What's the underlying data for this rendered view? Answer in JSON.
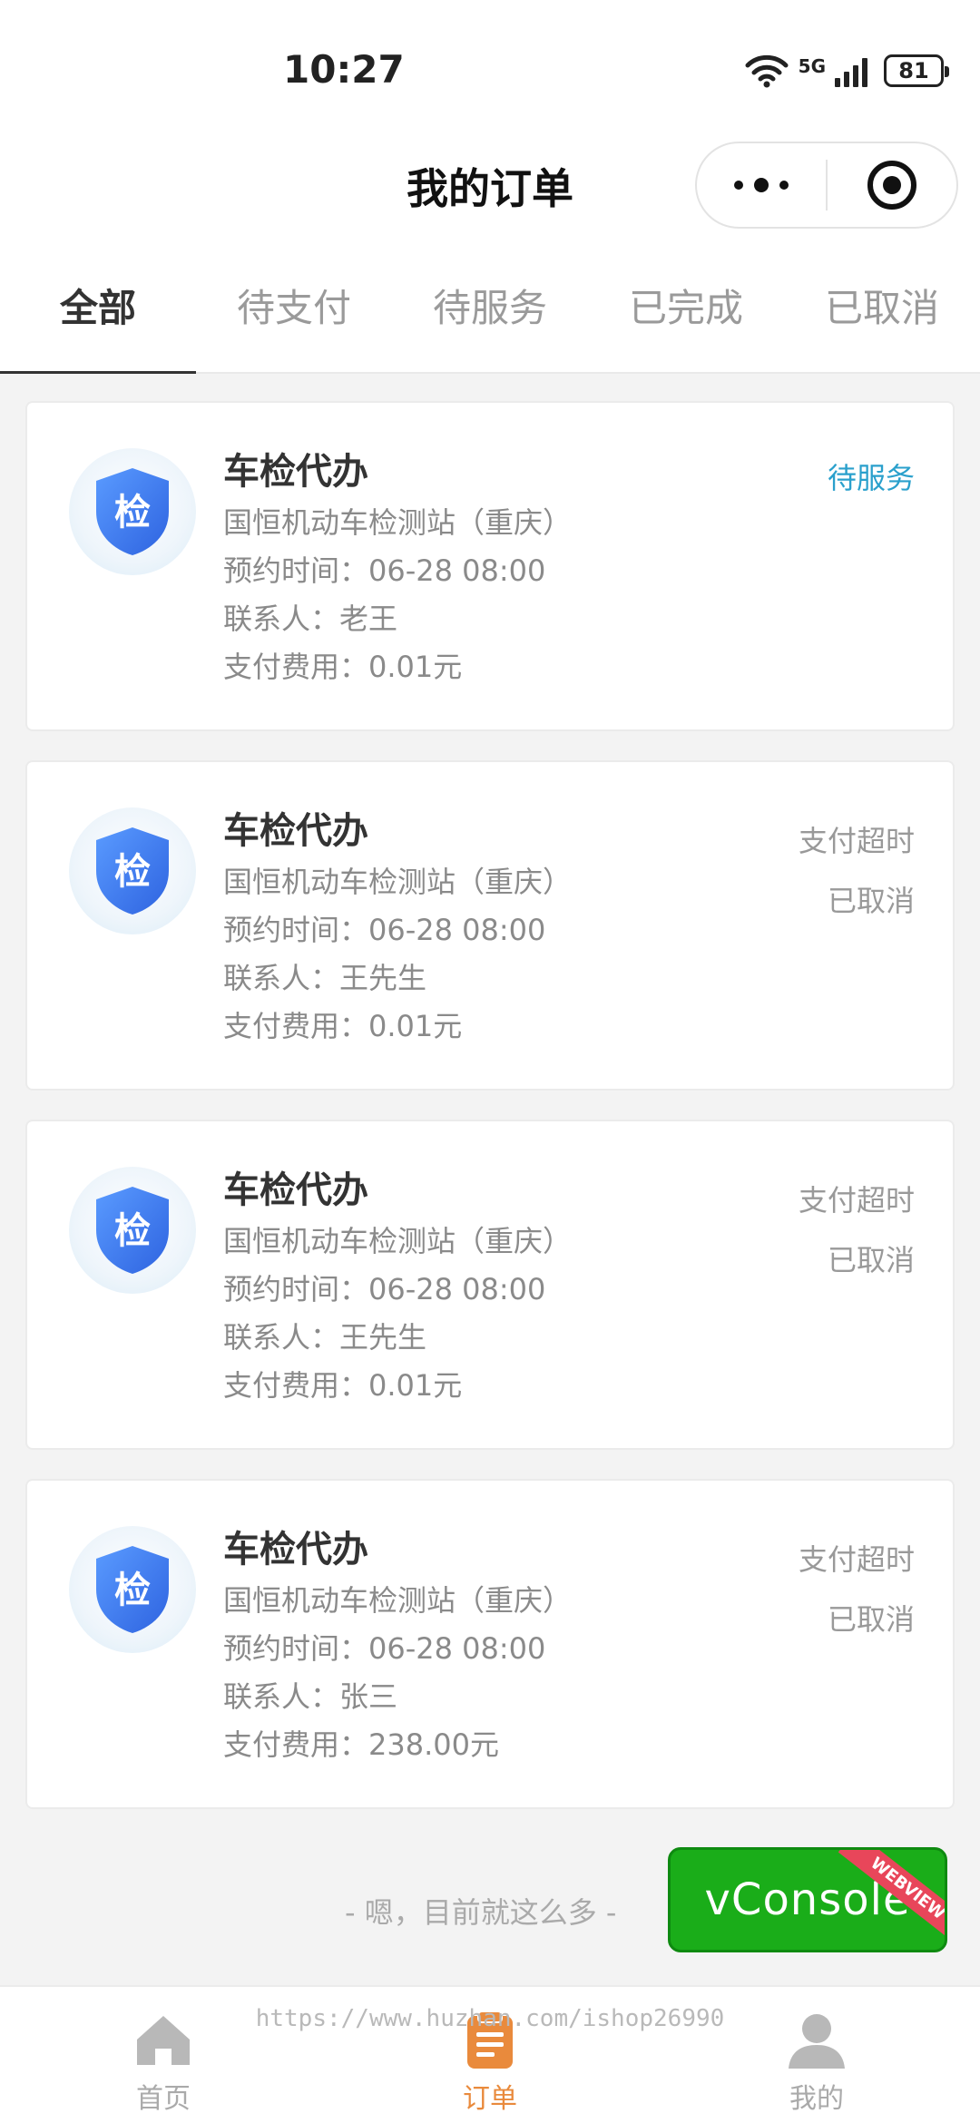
{
  "status_bar": {
    "time": "10:27",
    "network": "5G",
    "battery": "81"
  },
  "nav": {
    "title": "我的订单"
  },
  "tabs": [
    {
      "label": "全部",
      "active": true
    },
    {
      "label": "待支付",
      "active": false
    },
    {
      "label": "待服务",
      "active": false
    },
    {
      "label": "已完成",
      "active": false
    },
    {
      "label": "已取消",
      "active": false
    }
  ],
  "orders": [
    {
      "icon_text": "检",
      "title": "车检代办",
      "station": "国恒机动车检测站（重庆）",
      "appointment": "预约时间：06-28 08:00",
      "contact": "联系人：老王",
      "fee": "支付费用：0.01元",
      "status_lines": [
        "待服务"
      ]
    },
    {
      "icon_text": "检",
      "title": "车检代办",
      "station": "国恒机动车检测站（重庆）",
      "appointment": "预约时间：06-28 08:00",
      "contact": "联系人：王先生",
      "fee": "支付费用：0.01元",
      "status_lines": [
        "支付超时",
        "已取消"
      ]
    },
    {
      "icon_text": "检",
      "title": "车检代办",
      "station": "国恒机动车检测站（重庆）",
      "appointment": "预约时间：06-28 08:00",
      "contact": "联系人：王先生",
      "fee": "支付费用：0.01元",
      "status_lines": [
        "支付超时",
        "已取消"
      ]
    },
    {
      "icon_text": "检",
      "title": "车检代办",
      "station": "国恒机动车检测站（重庆）",
      "appointment": "预约时间：06-28 08:00",
      "contact": "联系人：张三",
      "fee": "支付费用：238.00元",
      "status_lines": [
        "支付超时",
        "已取消"
      ]
    }
  ],
  "end_text": "- 嗯，目前就这么多 -",
  "vconsole": {
    "label": "vConsole",
    "ribbon": "WEBVIEW"
  },
  "watermark": "https://www.huzhan.com/ishop26990",
  "tabbar": [
    {
      "label": "首页",
      "icon": "home-icon",
      "active": false
    },
    {
      "label": "订单",
      "icon": "order-icon",
      "active": true
    },
    {
      "label": "我的",
      "icon": "user-icon",
      "active": false
    }
  ],
  "colors": {
    "accent_orange": "#e98a3c",
    "status_pending": "#2aa0cc",
    "vconsole_green": "#1aad19",
    "shield_blue": "#3f7ff0"
  }
}
